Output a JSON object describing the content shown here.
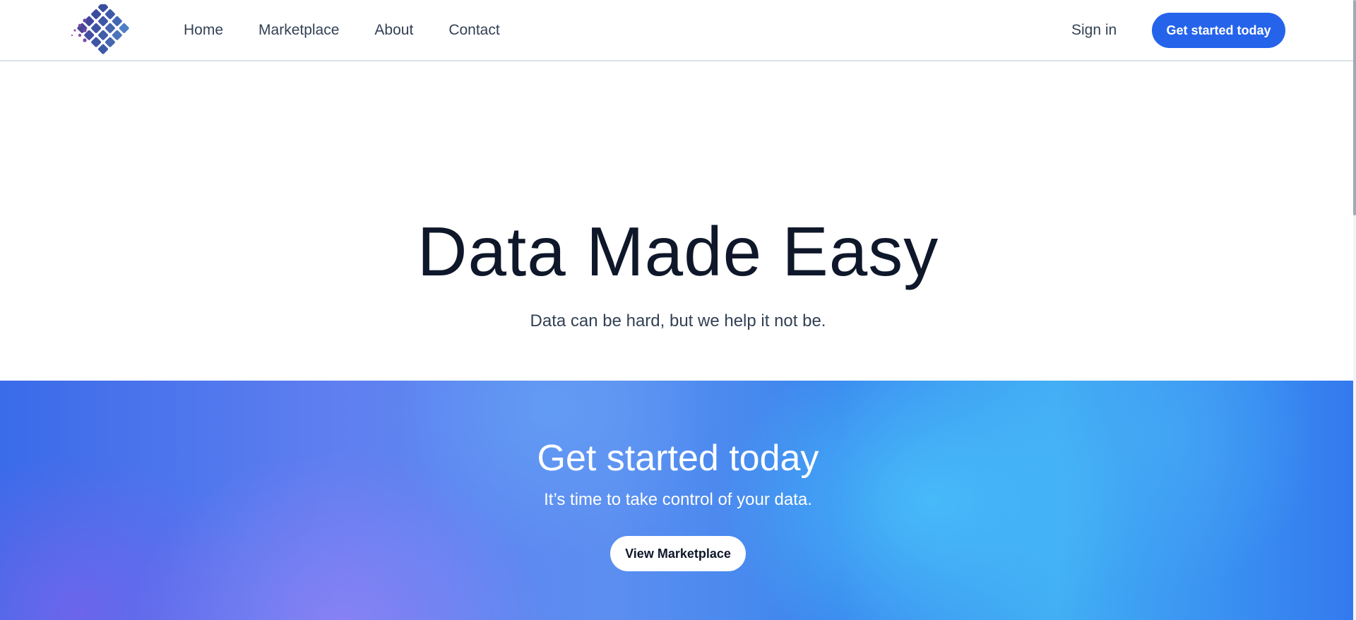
{
  "header": {
    "logo_icon": "diamond-dots-logo-icon",
    "nav": [
      {
        "label": "Home"
      },
      {
        "label": "Marketplace"
      },
      {
        "label": "About"
      },
      {
        "label": "Contact"
      }
    ],
    "sign_in_label": "Sign in",
    "cta_label": "Get started today"
  },
  "hero": {
    "title": "Data Made Easy",
    "subtitle": "Data can be hard, but we help it not be."
  },
  "cta_band": {
    "title": "Get started today",
    "subtitle": "It’s time to take control of your data.",
    "button_label": "View Marketplace"
  },
  "colors": {
    "primary": "#2563eb",
    "text_dark": "#0f172a",
    "text_muted": "#334155",
    "band_purple": "#7b6ff0",
    "band_cyan": "#41b2f5"
  }
}
